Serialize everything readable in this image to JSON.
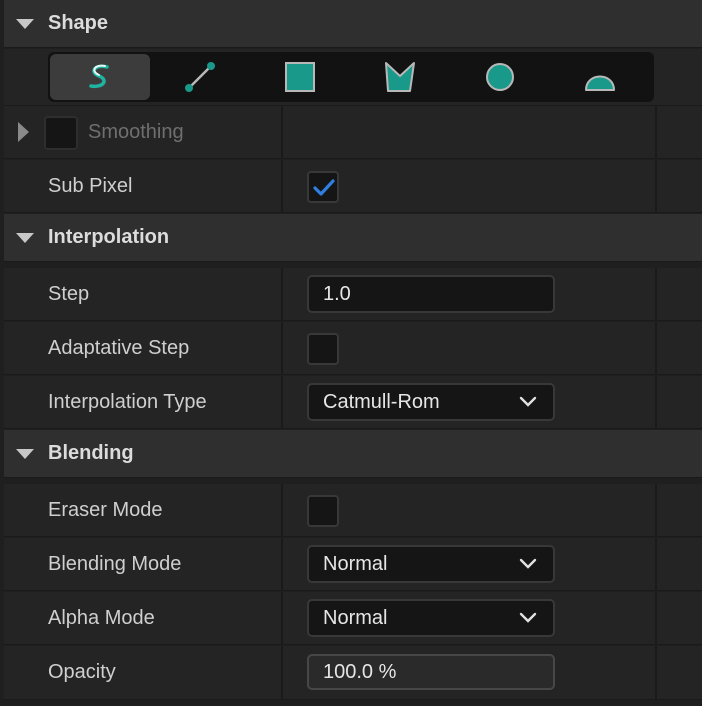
{
  "categories": {
    "shape": "Shape",
    "interpolation": "Interpolation",
    "blending": "Blending"
  },
  "shape_tools": {
    "active_index": 0,
    "items": [
      "freehand-stroke-icon",
      "line-icon",
      "square-icon",
      "polygon-icon",
      "circle-icon",
      "arc-icon"
    ],
    "accent_color": "#19998a"
  },
  "properties": {
    "smoothing": {
      "label": "Smoothing",
      "checked": false,
      "enabled": false
    },
    "sub_pixel": {
      "label": "Sub Pixel",
      "checked": true
    },
    "step": {
      "label": "Step",
      "value": "1.0"
    },
    "adaptative_step": {
      "label": "Adaptative Step",
      "checked": false
    },
    "interpolation_type": {
      "label": "Interpolation Type",
      "value": "Catmull-Rom"
    },
    "eraser_mode": {
      "label": "Eraser Mode",
      "checked": false
    },
    "blending_mode": {
      "label": "Blending Mode",
      "value": "Normal"
    },
    "alpha_mode": {
      "label": "Alpha Mode",
      "value": "Normal"
    },
    "opacity": {
      "label": "Opacity",
      "value": "100.0 %"
    }
  },
  "colors": {
    "check_blue": "#2f7fe0",
    "teal": "#19998a"
  }
}
